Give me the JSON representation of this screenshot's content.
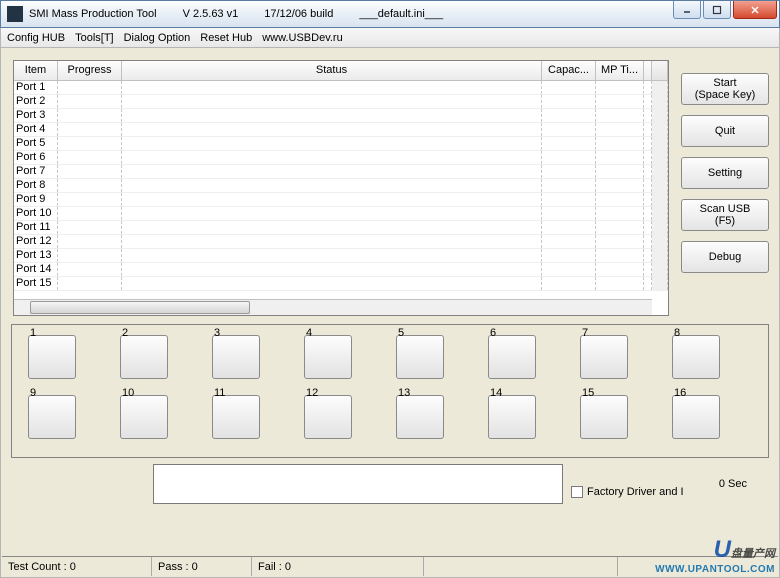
{
  "window": {
    "app": "SMI Mass Production Tool",
    "version": "V 2.5.63   v1",
    "build": "17/12/06 build",
    "ini": "___default.ini___"
  },
  "menu": {
    "config_hub": "Config HUB",
    "tools": "Tools[T]",
    "dialog_option": "Dialog Option",
    "reset_hub": "Reset Hub",
    "url": "www.USBDev.ru"
  },
  "table": {
    "headers": {
      "item": "Item",
      "progress": "Progress",
      "status": "Status",
      "capac": "Capac...",
      "mpti": "MP Ti..."
    },
    "rows": [
      "Port 1",
      "Port 2",
      "Port 3",
      "Port 4",
      "Port 5",
      "Port 6",
      "Port 7",
      "Port 8",
      "Port 9",
      "Port 10",
      "Port 11",
      "Port 12",
      "Port 13",
      "Port 14",
      "Port 15"
    ]
  },
  "side": {
    "start": "Start\n(Space Key)",
    "quit": "Quit",
    "setting": "Setting",
    "scan": "Scan USB\n(F5)",
    "debug": "Debug"
  },
  "ports": {
    "labels": [
      "1",
      "2",
      "3",
      "4",
      "5",
      "6",
      "7",
      "8",
      "9",
      "10",
      "11",
      "12",
      "13",
      "14",
      "15",
      "16"
    ]
  },
  "bottom": {
    "factory": "Factory Driver and I",
    "sec": "0 Sec"
  },
  "status": {
    "test_count": "Test Count : 0",
    "pass": "Pass : 0",
    "fail": "Fail : 0"
  },
  "watermark": {
    "brand": "盘量产网",
    "url": "WWW.UPANTOOL.COM"
  }
}
